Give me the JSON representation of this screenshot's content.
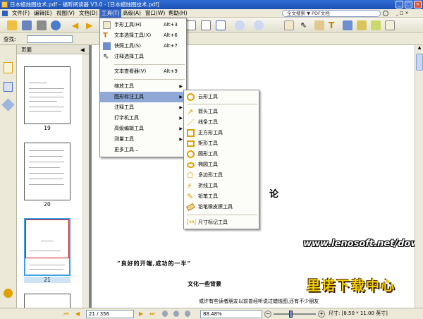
{
  "window": {
    "title": "日本蜡烛图技术.pdf - 福昕阅读器 V3.0 - [日本蜡烛图技术.pdf]"
  },
  "menubar": {
    "items": [
      "文件(F)",
      "编辑(E)",
      "视图(V)",
      "文档(D)",
      "工具(T)",
      "高级(A)",
      "窗口(W)",
      "帮助(H)"
    ],
    "search_placeholder": "全文搜索 ▼ PDF文档"
  },
  "toolbar2": {
    "find_label": "查找:"
  },
  "left_panel": {
    "header": "页面",
    "thumbs": [
      {
        "label": "19"
      },
      {
        "label": "20"
      },
      {
        "label": "21"
      }
    ]
  },
  "tools_menu": {
    "items": [
      {
        "label": "手形工具(H)",
        "shortcut": "Alt+3",
        "icon": "hand-icon"
      },
      {
        "label": "文本选择工具(X)",
        "shortcut": "Alt+6",
        "icon": "text-select-icon"
      },
      {
        "label": "快照工具(S)",
        "shortcut": "Alt+7",
        "icon": "camera-icon"
      },
      {
        "label": "注释选择工具",
        "shortcut": "",
        "icon": "annotation-select-icon"
      },
      {
        "label": "文本查看器(V)",
        "shortcut": "Alt+9",
        "icon": ""
      },
      {
        "label": "缩放工具",
        "shortcut": "",
        "icon": ""
      },
      {
        "label": "图形标注工具",
        "shortcut": "",
        "icon": ""
      },
      {
        "label": "注释工具",
        "shortcut": "",
        "icon": ""
      },
      {
        "label": "打字机工具",
        "shortcut": "",
        "icon": ""
      },
      {
        "label": "高级编辑工具",
        "shortcut": "",
        "icon": ""
      },
      {
        "label": "测量工具",
        "shortcut": "",
        "icon": ""
      },
      {
        "label": "更多工具...",
        "shortcut": "",
        "icon": ""
      }
    ]
  },
  "shape_submenu": {
    "items": [
      {
        "label": "云形工具",
        "icon": "cloud-icon"
      },
      {
        "label": "箭头工具",
        "icon": "arrow-icon"
      },
      {
        "label": "线条工具",
        "icon": "line-icon"
      },
      {
        "label": "正方形工具",
        "icon": "square-icon"
      },
      {
        "label": "矩形工具",
        "icon": "rectangle-icon"
      },
      {
        "label": "圆形工具",
        "icon": "circle-icon"
      },
      {
        "label": "椭圆工具",
        "icon": "ellipse-icon"
      },
      {
        "label": "多边形工具",
        "icon": "polygon-icon"
      },
      {
        "label": "折线工具",
        "icon": "polyline-icon"
      },
      {
        "label": "铅笔工具",
        "icon": "pencil-icon"
      },
      {
        "label": "铅笔橡皮擦工具",
        "icon": "eraser-icon"
      },
      {
        "label": "尺寸标记工具",
        "icon": "dimension-icon"
      }
    ]
  },
  "document": {
    "char_fragment": "论",
    "quote": "“良好的开端,成功的一半”",
    "section_heading": "文化一些背景",
    "body_line": "或许有些读者朋友以前曾经听说过蜡烛图,还有不少朋友"
  },
  "watermark": {
    "site": "www.lenosoft.net/down/",
    "brand": "里诺下载中心"
  },
  "statusbar": {
    "page_field": "21 / 356",
    "zoom": "88.48%",
    "size_label": "尺寸: [8.50 * 11.00 英寸]"
  },
  "colors": {
    "titlebar": "#1d4fb2",
    "menu_highlight": "#3a66c4",
    "item_highlight": "#8fa8d6",
    "accent_orange": "#e0a000",
    "brand_yellow": "#f2d000"
  }
}
